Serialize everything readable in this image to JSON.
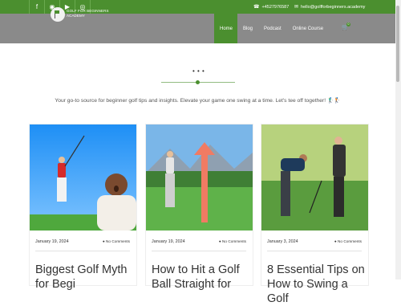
{
  "topbar": {
    "social": [
      {
        "icon": "facebook-icon",
        "glyph": "f"
      },
      {
        "icon": "pinterest-icon",
        "glyph": "◉"
      },
      {
        "icon": "youtube-icon",
        "glyph": "▶"
      },
      {
        "icon": "instagram-icon",
        "glyph": "◎"
      }
    ],
    "phone": "+4527976587",
    "email": "hello@golfforbeginners.academy"
  },
  "logo": {
    "line1": "GOLF FOR BEGINNERS",
    "line2": "ACADEMY"
  },
  "nav": {
    "items": [
      "Home",
      "Blog",
      "Podcast",
      "Online Course"
    ],
    "active": "Home"
  },
  "cart": {
    "count": "0"
  },
  "hero": {
    "ellipsis": "• • •",
    "tagline": "Your go-to source for beginner golf tips and insights. Elevate your game one swing at a time. Let's tee off together! 🏌️‍♂️🏌️"
  },
  "posts": [
    {
      "date": "January 19, 2024",
      "comments": "No Comments",
      "title": "Biggest Golf Myth for Begi"
    },
    {
      "date": "January 19, 2024",
      "comments": "No Comments",
      "title": "How to Hit a Golf Ball Straight for"
    },
    {
      "date": "January 3, 2024",
      "comments": "No Comments",
      "title": "8 Essential Tips on How to Swing a Golf"
    }
  ],
  "colors": {
    "brand_green": "#4b8f2f",
    "header_gray": "#8a8a8a"
  }
}
